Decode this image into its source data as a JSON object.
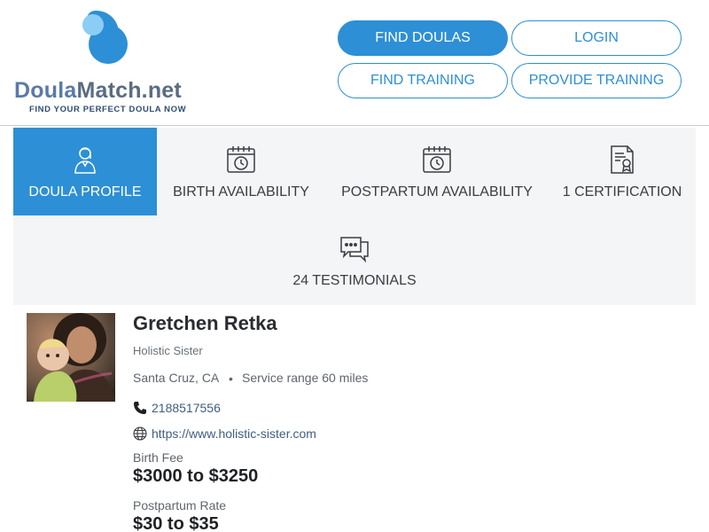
{
  "brand": {
    "name_part1": "Doula",
    "name_part2": "Match.net",
    "tagline": "FIND YOUR PERFECT DOULA NOW",
    "accent_color": "#2d8fd6",
    "logo_icon": "droplet-logo-icon"
  },
  "header": {
    "find_doulas": "FIND DOULAS",
    "login": "LOGIN",
    "find_training": "FIND TRAINING",
    "provide_training": "PROVIDE TRAINING"
  },
  "tabs": [
    {
      "label": "DOULA PROFILE",
      "icon": "doula-avatar-icon",
      "active": true
    },
    {
      "label": "BIRTH AVAILABILITY",
      "icon": "calendar-clock-icon",
      "active": false
    },
    {
      "label": "POSTPARTUM AVAILABILITY",
      "icon": "calendar-clock-icon",
      "active": false
    },
    {
      "label": "1 CERTIFICATION",
      "icon": "certificate-icon",
      "active": false
    },
    {
      "label": "24 TESTIMONIALS",
      "icon": "speech-bubbles-icon",
      "active": false
    }
  ],
  "profile": {
    "name": "Gretchen Retka",
    "business": "Holistic Sister",
    "location": "Santa Cruz, CA",
    "separator": "•",
    "service_range": "Service range 60 miles",
    "phone": "2188517556",
    "website": "https://www.holistic-sister.com",
    "birth_fee_label": "Birth Fee",
    "birth_fee": "$3000 to $3250",
    "postpartum_label": "Postpartum Rate",
    "postpartum_rate": "$30 to $35"
  }
}
